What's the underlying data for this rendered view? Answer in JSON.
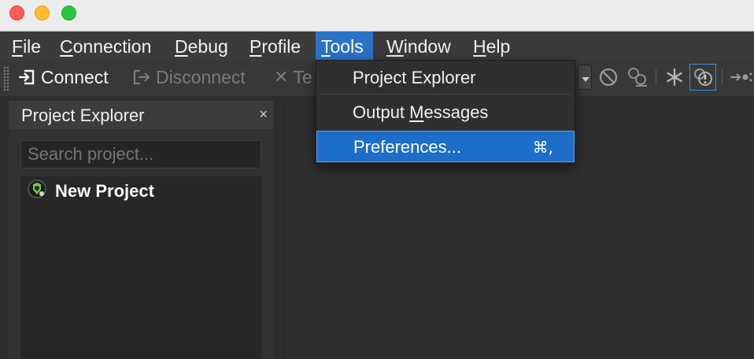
{
  "window": {
    "traffic_lights": [
      "close",
      "minimize",
      "zoom"
    ]
  },
  "menubar": {
    "items": [
      {
        "pre": "",
        "mn": "F",
        "post": "ile"
      },
      {
        "pre": "",
        "mn": "C",
        "post": "onnection"
      },
      {
        "pre": "",
        "mn": "D",
        "post": "ebug"
      },
      {
        "pre": "",
        "mn": "P",
        "post": "rofile"
      },
      {
        "pre": "",
        "mn": "T",
        "post": "ools"
      },
      {
        "pre": "",
        "mn": "W",
        "post": "indow"
      },
      {
        "pre": "",
        "mn": "H",
        "post": "elp"
      }
    ],
    "active": "Tools"
  },
  "toolbar": {
    "connect_label": "Connect",
    "disconnect_label": "Disconnect",
    "partial_label": "Te"
  },
  "tools_menu": {
    "items": [
      {
        "pre": "Project Explorer",
        "mn": "",
        "post": "",
        "shortcut": ""
      },
      {
        "pre": "Output ",
        "mn": "M",
        "post": "essages",
        "shortcut": ""
      },
      {
        "pre": "Preferences...",
        "mn": "",
        "post": "",
        "shortcut": "⌘,"
      }
    ],
    "highlighted": "Preferences..."
  },
  "project_explorer": {
    "title": "Project Explorer",
    "close_glyph": "×",
    "search_placeholder": "Search project...",
    "items": [
      {
        "label": "New Project"
      }
    ]
  },
  "colors": {
    "menu_highlight": "#2b72c7",
    "item_highlight": "#1d6ec9",
    "background": "#2d2d2d"
  }
}
